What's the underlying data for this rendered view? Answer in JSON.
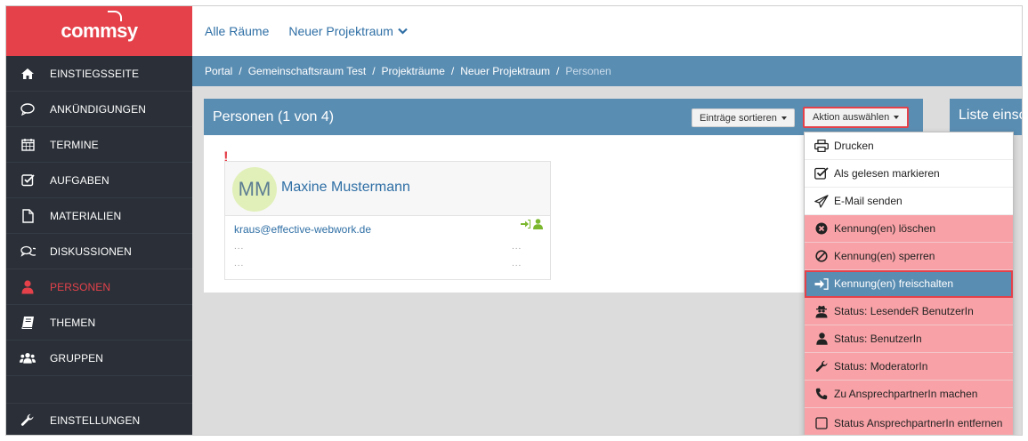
{
  "brand": {
    "logo_text": "commsy",
    "accent_color": "#e4414a",
    "sidebar_bg": "#2b3038",
    "header_blue": "#5a8db2"
  },
  "sidebar": {
    "items": [
      {
        "label": "EINSTIEGSSEITE",
        "icon": "home-icon"
      },
      {
        "label": "ANKÜNDIGUNGEN",
        "icon": "speech-bubble-icon"
      },
      {
        "label": "TERMINE",
        "icon": "calendar-icon"
      },
      {
        "label": "AUFGABEN",
        "icon": "checkbox-icon"
      },
      {
        "label": "MATERIALIEN",
        "icon": "document-icon"
      },
      {
        "label": "DISKUSSIONEN",
        "icon": "discussion-icon"
      },
      {
        "label": "PERSONEN",
        "icon": "person-icon",
        "active": true
      },
      {
        "label": "THEMEN",
        "icon": "book-icon"
      },
      {
        "label": "GRUPPEN",
        "icon": "group-icon"
      }
    ],
    "settings_label": "EINSTELLUNGEN"
  },
  "topbar": {
    "all_rooms": "Alle Räume",
    "current_room": "Neuer Projektraum"
  },
  "breadcrumb": [
    "Portal",
    "Gemeinschaftsraum Test",
    "Projekträume",
    "Neuer Projektraum",
    "Personen"
  ],
  "panel": {
    "title": "Personen (1 von 4)",
    "sort_label": "Einträge sortieren",
    "action_label": "Aktion auswählen"
  },
  "panel2": {
    "title": "Liste einsc"
  },
  "person": {
    "initials": "MM",
    "name": "Maxine Mustermann",
    "email": "kraus@effective-webwork.de",
    "placeholder": "..."
  },
  "dropdown": [
    {
      "label": "Drucken",
      "icon": "print-icon",
      "style": "plain"
    },
    {
      "label": "Als gelesen markieren",
      "icon": "check-square-icon",
      "style": "plain"
    },
    {
      "label": "E-Mail senden",
      "icon": "paper-plane-icon",
      "style": "plain"
    },
    {
      "label": "Kennung(en) löschen",
      "icon": "times-circle-icon",
      "style": "pink"
    },
    {
      "label": "Kennung(en) sperren",
      "icon": "ban-icon",
      "style": "pink"
    },
    {
      "label": "Kennung(en) freischalten",
      "icon": "sign-in-icon",
      "style": "selected"
    },
    {
      "label": "Status: LesendeR BenutzerIn",
      "icon": "user-secret-icon",
      "style": "pink"
    },
    {
      "label": "Status: BenutzerIn",
      "icon": "user-icon",
      "style": "pink"
    },
    {
      "label": "Status: ModeratorIn",
      "icon": "wrench-icon",
      "style": "pink"
    },
    {
      "label": "Zu AnsprechpartnerIn machen",
      "icon": "phone-icon",
      "style": "pink"
    },
    {
      "label": "Status AnsprechpartnerIn entfernen",
      "icon": "square-icon",
      "style": "pink"
    }
  ]
}
